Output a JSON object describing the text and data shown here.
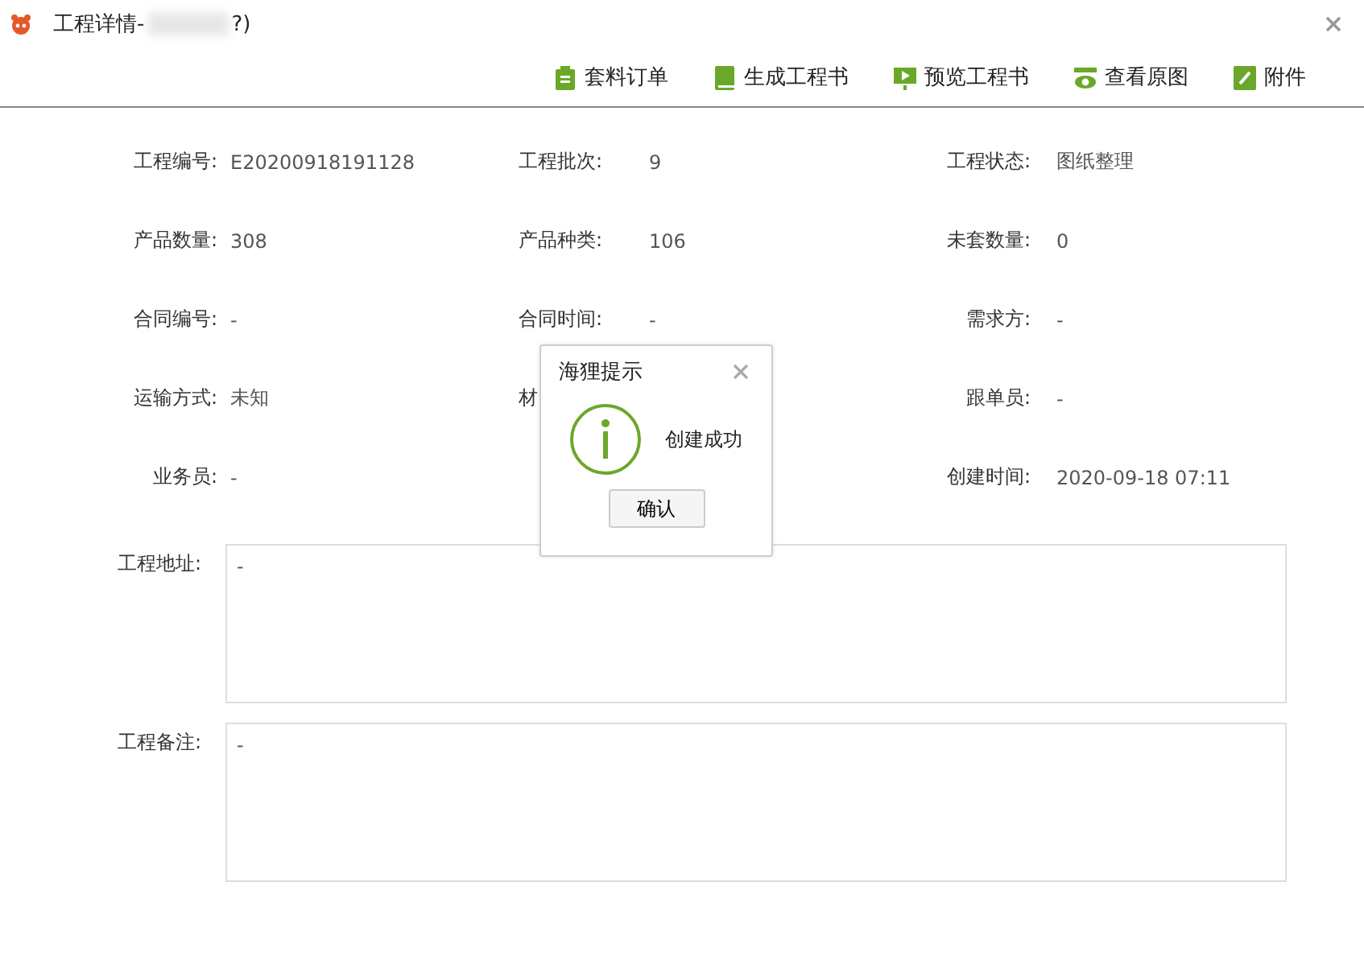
{
  "window": {
    "title": "工程详情-",
    "title_suffix": "?)"
  },
  "toolbar": [
    {
      "label": "套料订单",
      "kind": "clipboard"
    },
    {
      "label": "生成工程书",
      "kind": "book"
    },
    {
      "label": "预览工程书",
      "kind": "play"
    },
    {
      "label": "查看原图",
      "kind": "eye"
    },
    {
      "label": "附件",
      "kind": "clip"
    }
  ],
  "rows": [
    {
      "left": {
        "label": "工程编号:",
        "value": "E20200918191128"
      },
      "middle": {
        "label": "工程批次:",
        "value": "9"
      },
      "right": {
        "label": "工程状态:",
        "value": "图纸整理"
      }
    },
    {
      "left": {
        "label": "产品数量:",
        "value": "308"
      },
      "middle": {
        "label": "产品种类:",
        "value": "106"
      },
      "right": {
        "label": "未套数量:",
        "value": "0"
      }
    },
    {
      "left": {
        "label": "合同编号:",
        "value": "-"
      },
      "middle": {
        "label": "合同时间:",
        "value": "-"
      },
      "right": {
        "label": "需求方:",
        "value": "-"
      }
    },
    {
      "left": {
        "label": "运输方式:",
        "value": "未知"
      },
      "middle": {
        "label": "材"
      },
      "right": {
        "label": "跟单员:",
        "value": "-"
      }
    },
    {
      "left": {
        "label": "业务员:",
        "value": "-"
      },
      "right": {
        "label": "创建时间:",
        "value": "2020-09-18 07:11"
      }
    }
  ],
  "textareas": [
    {
      "label": "工程地址:",
      "value": "-"
    },
    {
      "label": "工程备注:",
      "value": "-"
    }
  ],
  "dialog": {
    "title": "海狸提示",
    "message": "创建成功",
    "button": "确认"
  }
}
